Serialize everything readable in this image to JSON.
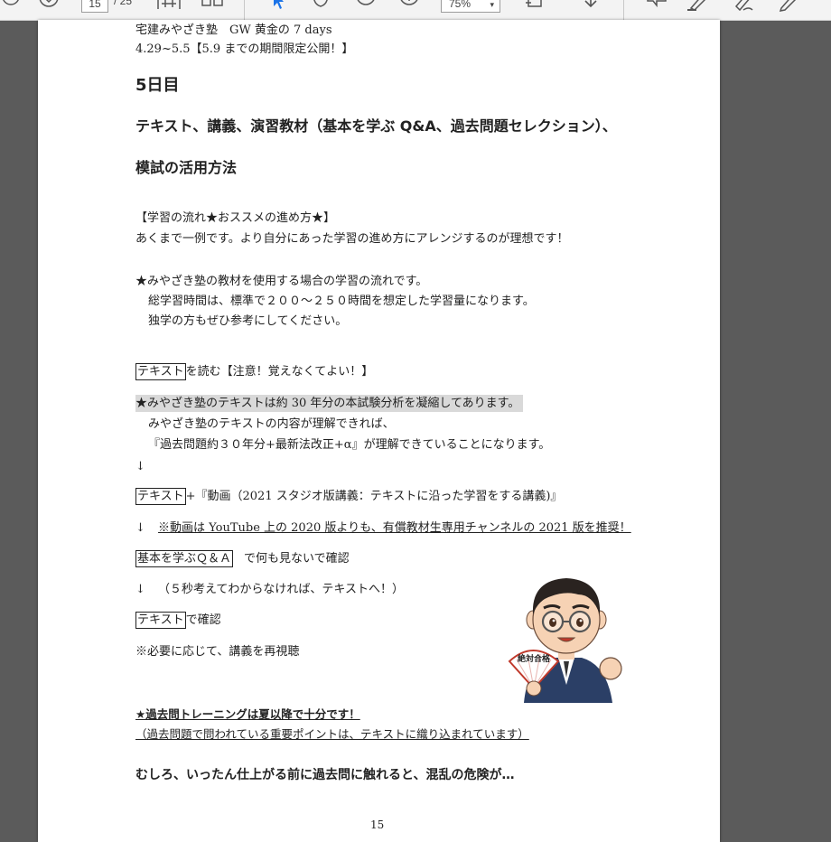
{
  "toolbar": {
    "page_current": "15",
    "page_total": "/ 25",
    "zoom": "75%"
  },
  "document": {
    "header_line1": "宅建みやざき塾　GW 黄金の 7 days",
    "header_line2": "4.29~5.5【5.9 までの期間限定公開！】",
    "day_title": "5日目",
    "subtitle1": "テキスト、講義、演習教材（基本を学ぶ Q&A、過去問題セレクション）、",
    "subtitle2": "模試の活用方法",
    "flow_heading": "【学習の流れ★おススメの進め方★】",
    "flow_note": "あくまで一例です。より自分にあった学習の進め方にアレンジするのが理想です！",
    "material_intro": "★みやざき塾の教材を使用する場合の学習の流れです。",
    "total_hours": "総学習時間は、標準で２００～２５０時間を想定した学習量になります。",
    "self_study": "独学の方もぜひ参考にしてください。",
    "step1_box": "テキスト",
    "step1_text": "を読む【注意！覚えなくてよい！】",
    "text_highlight": "★みやざき塾のテキストは約 30 年分の本試験分析を凝縮してあります。",
    "text_understand": "みやざき塾のテキストの内容が理解できれば、",
    "text_past": "『過去問題約３０年分+最新法改正+α』が理解できていることになります。",
    "arrow1": "↓",
    "step2_box": "テキスト",
    "step2_text": "+『動画（2021 スタジオ版講義：テキストに沿った学習をする講義)』",
    "arrow2": "↓",
    "video_note": "※動画は YouTube 上の 2020 版よりも、有償教材生専用チャンネルの 2021 版を推奨！",
    "step3_box": "基本を学ぶＱ＆Ａ",
    "step3_text": "で何も見ないで確認",
    "arrow3": "↓",
    "step3_note": "（５秒考えてわからなければ、テキストへ！）",
    "step4_box": "テキスト",
    "step4_text": "で確認",
    "rewatch": "※必要に応じて、講義を再視聴",
    "mascot_fan_text": "絶対合格",
    "past_training": "★過去問トレーニングは夏以降で十分です！",
    "past_note": "（過去問題で問われている重要ポイントは、テキストに織り込まれています）",
    "warning": "むしろ、いったん仕上がる前に過去問に触れると、混乱の危険が…",
    "page_number": "15"
  }
}
